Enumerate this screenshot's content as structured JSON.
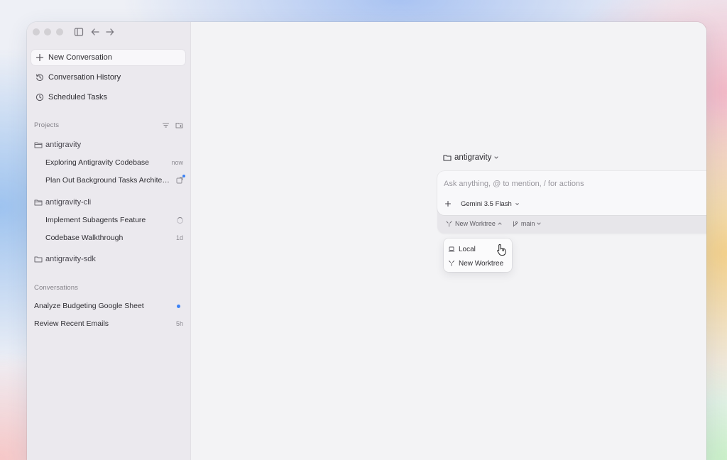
{
  "sidebar": {
    "nav": {
      "new_conversation": "New Conversation",
      "conversation_history": "Conversation History",
      "scheduled_tasks": "Scheduled Tasks"
    },
    "projects_label": "Projects",
    "projects": [
      {
        "name": "antigravity",
        "conversations": [
          {
            "title": "Exploring Antigravity Codebase",
            "meta": "now"
          },
          {
            "title": "Plan Out Background Tasks Architecture",
            "meta": ""
          }
        ]
      },
      {
        "name": "antigravity-cli",
        "conversations": [
          {
            "title": "Implement Subagents Feature",
            "meta": ""
          },
          {
            "title": "Codebase Walkthrough",
            "meta": "1d"
          }
        ]
      },
      {
        "name": "antigravity-sdk",
        "conversations": []
      }
    ],
    "conversations_label": "Conversations",
    "conversations": [
      {
        "title": "Analyze Budgeting Google Sheet",
        "meta": ""
      },
      {
        "title": "Review Recent Emails",
        "meta": "5h"
      }
    ]
  },
  "composer": {
    "project": "antigravity",
    "placeholder": "Ask anything, @ to mention, / for actions",
    "model": "Gemini 3.5 Flash",
    "worktree": "New Worktree",
    "branch": "main"
  },
  "worktree_dropdown": {
    "options": [
      "Local",
      "New Worktree"
    ]
  },
  "colors": {
    "accent_dot": "#3b82f6",
    "sidebar_bg": "#ebe9ee",
    "main_bg": "#f3f3f5"
  },
  "icons": [
    "sidebar-toggle-icon",
    "back-arrow-icon",
    "forward-arrow-icon",
    "plus-icon",
    "history-icon",
    "clock-icon",
    "filter-icon",
    "new-folder-icon",
    "folder-icon",
    "spinner-icon",
    "external-link-icon",
    "mic-icon",
    "worktree-icon",
    "branch-icon",
    "laptop-icon",
    "pointer-cursor-icon"
  ]
}
